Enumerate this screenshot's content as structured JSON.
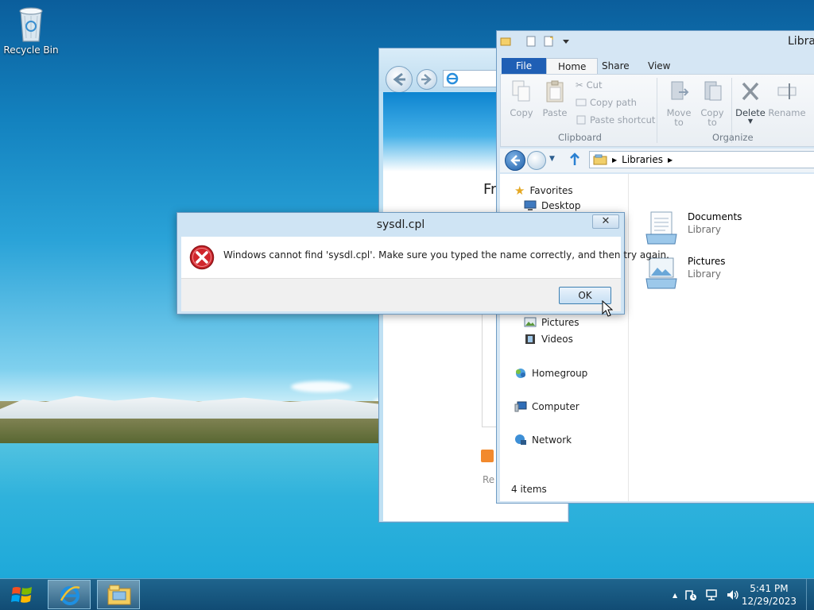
{
  "desktop": {
    "recycle_bin_label": "Recycle Bin"
  },
  "ie": {
    "heading_partial": "Fr",
    "link_partial": "Re"
  },
  "explorer": {
    "title": "Librar",
    "tabs": [
      "File",
      "Home",
      "Share",
      "View"
    ],
    "ribbon": {
      "copy": "Copy",
      "paste": "Paste",
      "cut": "Cut",
      "copy_path": "Copy path",
      "paste_shortcut": "Paste shortcut",
      "clipboard_group": "Clipboard",
      "move_to": "Move",
      "move_to_2": "to",
      "copy_to": "Copy",
      "copy_to_2": "to",
      "delete": "Delete",
      "rename": "Rename",
      "organize_group": "Organize"
    },
    "address": {
      "crumb": "Libraries"
    },
    "nav": {
      "favorites": "Favorites",
      "desktop": "Desktop",
      "pictures": "Pictures",
      "videos": "Videos",
      "homegroup": "Homegroup",
      "computer": "Computer",
      "network": "Network"
    },
    "items": [
      {
        "name": "Documents",
        "type": "Library"
      },
      {
        "name": "Pictures",
        "type": "Library"
      }
    ],
    "status": "4 items"
  },
  "dialog": {
    "title": "sysdl.cpl",
    "close": "✕",
    "message": "Windows cannot find 'sysdl.cpl'. Make sure you typed the name correctly, and then try again.",
    "ok": "OK"
  },
  "taskbar": {
    "time": "5:41 PM",
    "date": "12/29/2023",
    "tray_arrow": "▲"
  },
  "colors": {
    "file_tab": "#1f5fb5",
    "error_red": "#d0262c",
    "taskbar": "#1e5f87"
  }
}
